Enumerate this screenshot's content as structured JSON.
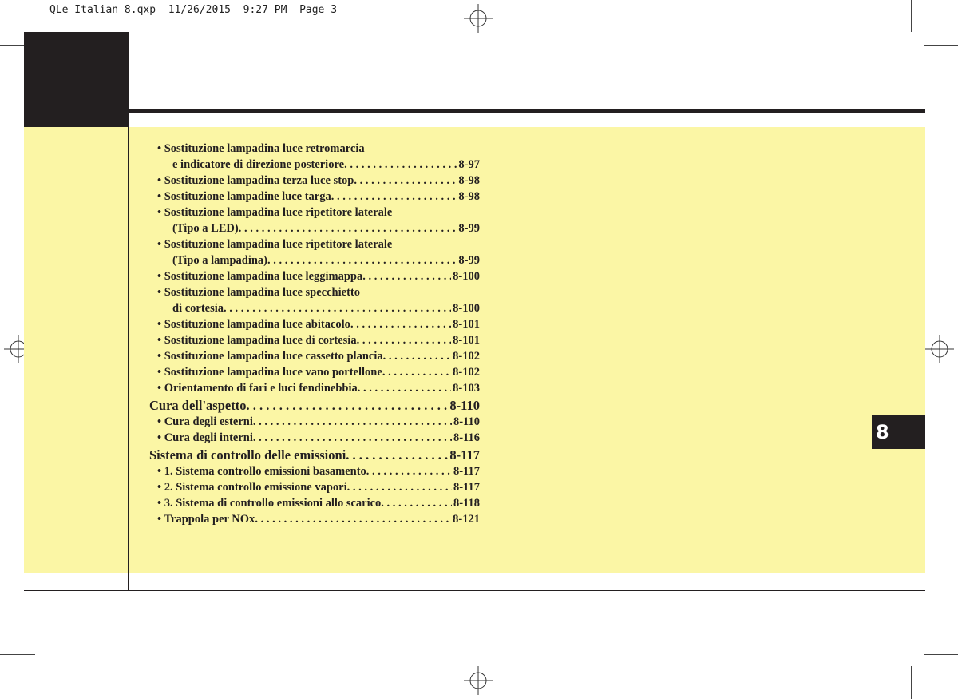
{
  "header": {
    "slug": "QLe Italian 8.qxp  11/26/2015  9:27 PM  Page 3"
  },
  "chapter_tab": {
    "number": "8"
  },
  "toc": [
    {
      "kind": "item",
      "text": "• Sostituzione lampadina luce retromarcia",
      "page": ""
    },
    {
      "kind": "cont",
      "text": "e indicatore di direzione posteriore",
      "page": "8-97"
    },
    {
      "kind": "item",
      "text": "• Sostituzione lampadina terza luce stop",
      "page": "8-98"
    },
    {
      "kind": "item",
      "text": "• Sostituzione lampadine luce targa",
      "page": "8-98"
    },
    {
      "kind": "item",
      "text": "• Sostituzione lampadina luce ripetitore laterale",
      "page": ""
    },
    {
      "kind": "cont",
      "text": "(Tipo a LED)",
      "page": "8-99"
    },
    {
      "kind": "item",
      "text": "• Sostituzione lampadina luce ripetitore laterale",
      "page": ""
    },
    {
      "kind": "cont",
      "text": "(Tipo a lampadina)",
      "page": "8-99"
    },
    {
      "kind": "item",
      "text": "• Sostituzione lampadina luce leggimappa",
      "page": "8-100"
    },
    {
      "kind": "item",
      "text": "• Sostituzione lampadina luce specchietto",
      "page": ""
    },
    {
      "kind": "cont",
      "text": "di cortesia",
      "page": "8-100"
    },
    {
      "kind": "item",
      "text": "• Sostituzione lampadina luce abitacolo",
      "page": "8-101"
    },
    {
      "kind": "item",
      "text": "• Sostituzione lampadina luce di cortesia",
      "page": "8-101"
    },
    {
      "kind": "item",
      "text": "• Sostituzione lampadina luce cassetto plancia",
      "page": "8-102"
    },
    {
      "kind": "item",
      "text": "• Sostituzione lampadina luce vano portellone",
      "page": "8-102"
    },
    {
      "kind": "item",
      "text": "• Orientamento di fari e luci fendinebbia",
      "page": "8-103"
    },
    {
      "kind": "section",
      "text": "Cura dell'aspetto",
      "page": "8-110"
    },
    {
      "kind": "item",
      "text": "• Cura degli esterni",
      "page": "8-110"
    },
    {
      "kind": "item",
      "text": "• Cura degli interni",
      "page": "8-116"
    },
    {
      "kind": "section",
      "text": "Sistema di controllo delle emissioni",
      "page": "8-117"
    },
    {
      "kind": "item",
      "text": "• 1. Sistema controllo emissioni basamento",
      "page": "8-117"
    },
    {
      "kind": "item",
      "text": "• 2. Sistema controllo emissione vapori",
      "page": "8-117"
    },
    {
      "kind": "item",
      "text": "• 3. Sistema di controllo emissioni allo scarico",
      "page": "8-118"
    },
    {
      "kind": "item",
      "text": "• Trappola per NOx",
      "page": "8-121"
    }
  ]
}
